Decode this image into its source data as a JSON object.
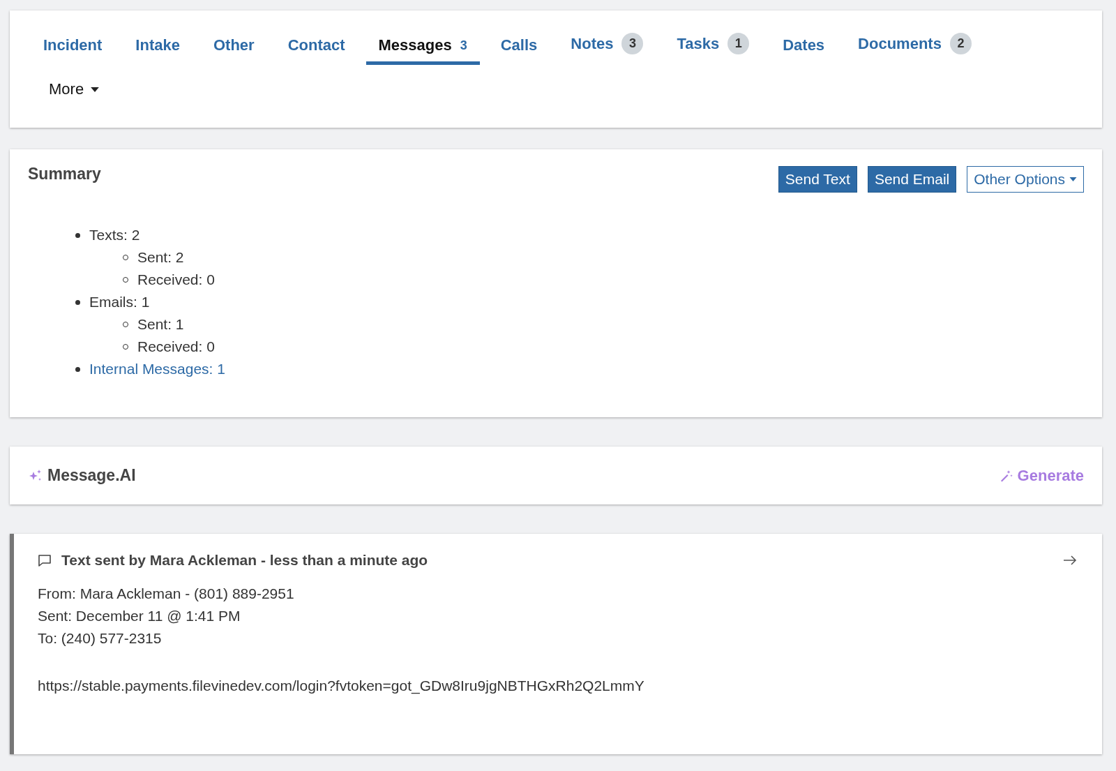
{
  "tabs": [
    {
      "label": "Incident",
      "selected": false
    },
    {
      "label": "Intake",
      "selected": false
    },
    {
      "label": "Other",
      "selected": false
    },
    {
      "label": "Contact",
      "selected": false
    },
    {
      "label": "Messages",
      "selected": true,
      "count": "3"
    },
    {
      "label": "Calls",
      "selected": false
    },
    {
      "label": "Notes",
      "selected": false,
      "count": "3"
    },
    {
      "label": "Tasks",
      "selected": false,
      "count": "1"
    },
    {
      "label": "Dates",
      "selected": false
    },
    {
      "label": "Documents",
      "selected": false,
      "count": "2"
    }
  ],
  "more_menu": {
    "label": "More"
  },
  "summary": {
    "title": "Summary",
    "buttons": [
      {
        "label": "Send Text",
        "kind": "primary"
      },
      {
        "label": "Send Email",
        "kind": "primary"
      },
      {
        "label": "Other Options",
        "kind": "dropdown"
      }
    ],
    "items": [
      {
        "text": "Texts: 2",
        "kind": "text",
        "children": [
          {
            "text": "Sent: 2"
          },
          {
            "text": "Received: 0"
          }
        ]
      },
      {
        "text": "Emails: 1",
        "kind": "text",
        "children": [
          {
            "text": "Sent: 1"
          },
          {
            "text": "Received: 0"
          }
        ]
      },
      {
        "text": "Internal Messages: 1",
        "kind": "link"
      }
    ]
  },
  "message_ai": {
    "title": "Message.AI",
    "action": "Generate"
  },
  "message": {
    "title": "Text sent by Mara Ackleman - less than a minute ago",
    "lines": [
      "From: Mara Ackleman - (801) 889-2951",
      "Sent: December 11 @ 1:41 PM",
      "To: (240) 577-2315"
    ],
    "body": "https://stable.payments.filevinedev.com/login?fvtoken=got_GDw8Iru9jgNBTHGxRh2Q2LmmY"
  }
}
